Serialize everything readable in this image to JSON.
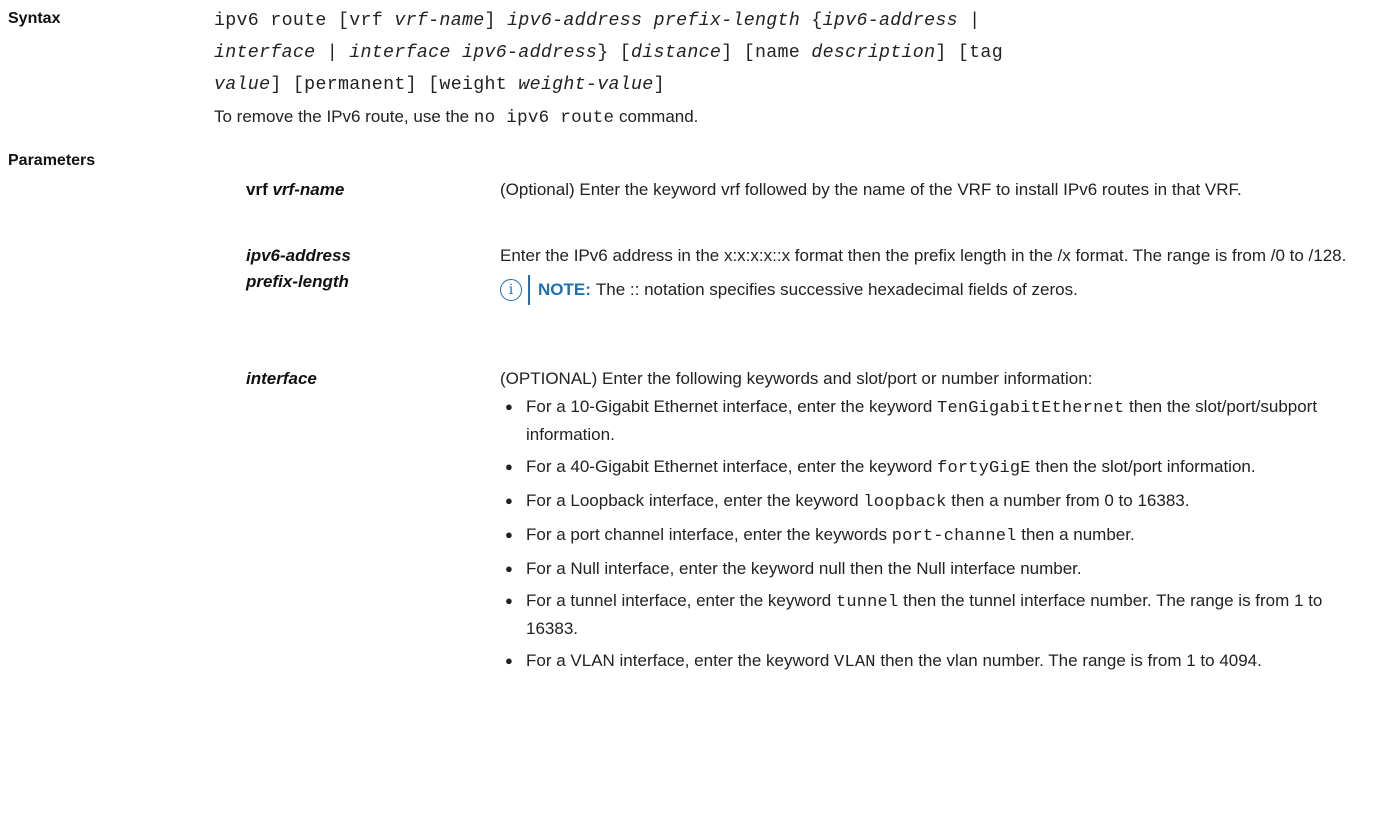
{
  "syntax": {
    "label": "Syntax",
    "lines": [
      [
        [
          "ipv6 route [vrf ",
          false
        ],
        [
          "vrf-name",
          true
        ],
        [
          "] ",
          false
        ],
        [
          "ipv6-address prefix-length",
          true
        ],
        [
          " {",
          false
        ],
        [
          "ipv6-address",
          true
        ],
        [
          " |",
          false
        ]
      ],
      [
        [
          "interface",
          true
        ],
        [
          " | ",
          false
        ],
        [
          "interface ipv6-address",
          true
        ],
        [
          "} [",
          false
        ],
        [
          "distance",
          true
        ],
        [
          "] [name ",
          false
        ],
        [
          "description",
          true
        ],
        [
          "] [tag",
          false
        ]
      ],
      [
        [
          "value",
          true
        ],
        [
          "] [permanent] [weight ",
          false
        ],
        [
          "weight-value",
          true
        ],
        [
          "]",
          false
        ]
      ]
    ],
    "remove_pre": "To remove the IPv6 route, use the ",
    "remove_cmd": "no ipv6 route",
    "remove_post": " command."
  },
  "parameters": {
    "label": "Parameters",
    "vrf": {
      "kw": "vrf",
      "arg": "vrf-name",
      "desc": "(Optional) Enter the keyword vrf followed by the name of the VRF to install IPv6 routes in that VRF."
    },
    "ipv6": {
      "name_line1": "ipv6-address",
      "name_line2": "prefix-length",
      "desc": "Enter the IPv6 address in the x:x:x:x::x format then the prefix length in the /x format. The range is from /0 to /128.",
      "note_label": "NOTE:",
      "note_text": "The :: notation specifies successive hexadecimal fields of zeros."
    },
    "interface": {
      "name": "interface",
      "intro": "(OPTIONAL) Enter the following keywords and slot/port or number information:",
      "bullets": [
        {
          "pre": "For a 10-Gigabit Ethernet interface, enter the keyword ",
          "kw": "TenGigabitEthernet",
          "post": " then the slot/port/subport information."
        },
        {
          "pre": "For a 40-Gigabit Ethernet interface, enter the keyword ",
          "kw": "fortyGigE",
          "post": " then the slot/port information."
        },
        {
          "pre": "For a Loopback interface, enter the keyword ",
          "kw": "loopback",
          "post": " then a number from 0 to 16383."
        },
        {
          "pre": "For a port channel interface, enter the keywords ",
          "kw": "port-channel",
          "post": " then a number."
        },
        {
          "pre": "For a Null interface, enter the keyword null then the Null interface number.",
          "kw": "",
          "post": ""
        },
        {
          "pre": "For a tunnel interface, enter the keyword ",
          "kw": "tunnel",
          "post": " then the tunnel interface number. The range is from 1 to 16383."
        },
        {
          "pre": "For a VLAN interface, enter the keyword ",
          "kw": "VLAN",
          "post": " then the vlan number. The range is from 1 to 4094."
        }
      ]
    }
  },
  "colors": {
    "note_accent": "#1d6fb8",
    "text": "#222222"
  }
}
